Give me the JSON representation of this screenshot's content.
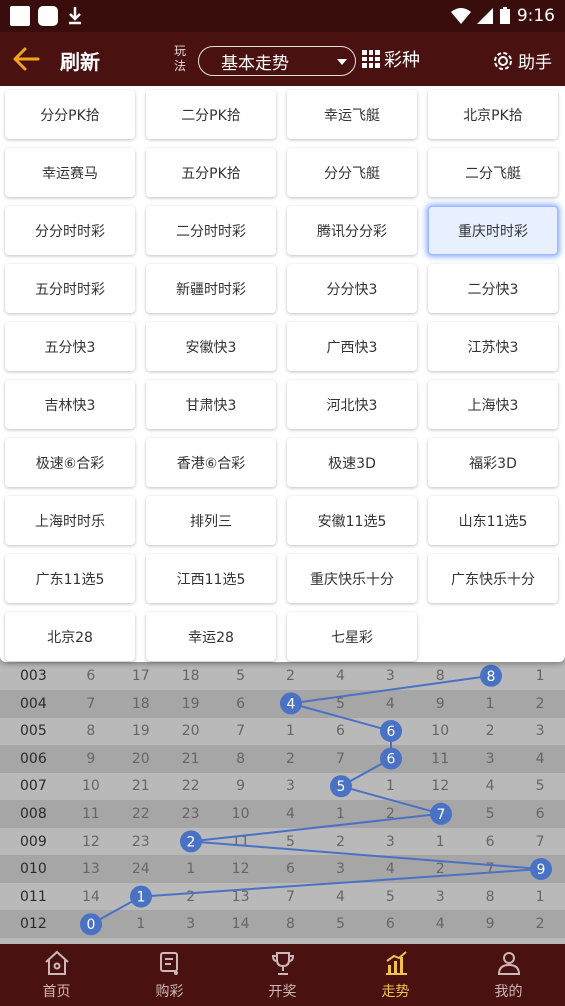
{
  "status_bar": {
    "time": "9:16"
  },
  "topbar": {
    "refresh_label": "刷新",
    "play_mode_label": "玩法",
    "mode_value": "基本走势",
    "lottery_type_label": "彩种",
    "helper_label": "助手"
  },
  "lotteries": [
    "分分PK拾",
    "二分PK拾",
    "幸运飞艇",
    "北京PK拾",
    "幸运赛马",
    "五分PK拾",
    "分分飞艇",
    "二分飞艇",
    "分分时时彩",
    "二分时时彩",
    "腾讯分分彩",
    "重庆时时彩",
    "五分时时彩",
    "新疆时时彩",
    "分分快3",
    "二分快3",
    "五分快3",
    "安徽快3",
    "广西快3",
    "江苏快3",
    "吉林快3",
    "甘肃快3",
    "河北快3",
    "上海快3",
    "极速⑥合彩",
    "香港⑥合彩",
    "极速3D",
    "福彩3D",
    "上海时时乐",
    "排列三",
    "安徽11选5",
    "山东11选5",
    "广东11选5",
    "江西11选5",
    "重庆快乐十分",
    "广东快乐十分",
    "北京28",
    "幸运28",
    "七星彩"
  ],
  "selected_lottery": "重庆时时彩",
  "trend_rows": [
    {
      "issue": "003",
      "cells": [
        "6",
        "17",
        "18",
        "5",
        "2",
        "4",
        "3",
        "8",
        "8",
        "1"
      ]
    },
    {
      "issue": "004",
      "cells": [
        "7",
        "18",
        "19",
        "6",
        "4",
        "5",
        "4",
        "9",
        "1",
        "2"
      ]
    },
    {
      "issue": "005",
      "cells": [
        "8",
        "19",
        "20",
        "7",
        "1",
        "6",
        "6",
        "10",
        "2",
        "3"
      ]
    },
    {
      "issue": "006",
      "cells": [
        "9",
        "20",
        "21",
        "8",
        "2",
        "7",
        "6",
        "11",
        "3",
        "4"
      ]
    },
    {
      "issue": "007",
      "cells": [
        "10",
        "21",
        "22",
        "9",
        "3",
        "5",
        "1",
        "12",
        "4",
        "5"
      ]
    },
    {
      "issue": "008",
      "cells": [
        "11",
        "22",
        "23",
        "10",
        "4",
        "1",
        "2",
        "7",
        "5",
        "6"
      ]
    },
    {
      "issue": "009",
      "cells": [
        "12",
        "23",
        "2",
        "11",
        "5",
        "2",
        "3",
        "1",
        "6",
        "7"
      ]
    },
    {
      "issue": "010",
      "cells": [
        "13",
        "24",
        "1",
        "12",
        "6",
        "3",
        "4",
        "2",
        "7",
        "9"
      ]
    },
    {
      "issue": "011",
      "cells": [
        "14",
        "1",
        "2",
        "13",
        "7",
        "4",
        "5",
        "3",
        "8",
        "1"
      ]
    },
    {
      "issue": "012",
      "cells": [
        "0",
        "1",
        "3",
        "14",
        "8",
        "5",
        "6",
        "4",
        "9",
        "2"
      ]
    }
  ],
  "trend_hits": [
    {
      "row": 0,
      "col": 8,
      "value": "8"
    },
    {
      "row": 1,
      "col": 4,
      "value": "4"
    },
    {
      "row": 2,
      "col": 6,
      "value": "6"
    },
    {
      "row": 3,
      "col": 6,
      "value": "6"
    },
    {
      "row": 4,
      "col": 5,
      "value": "5"
    },
    {
      "row": 5,
      "col": 7,
      "value": "7"
    },
    {
      "row": 6,
      "col": 2,
      "value": "2"
    },
    {
      "row": 7,
      "col": 9,
      "value": "9"
    },
    {
      "row": 8,
      "col": 1,
      "value": "1"
    },
    {
      "row": 9,
      "col": 0,
      "value": "0"
    }
  ],
  "colors": {
    "accent": "#f2c24b",
    "header": "#4a1111",
    "hit": "#4a72c4"
  },
  "bottom_nav": [
    {
      "label": "首页",
      "icon": "home-icon",
      "active": false
    },
    {
      "label": "购彩",
      "icon": "cart-icon",
      "active": false
    },
    {
      "label": "开奖",
      "icon": "trophy-icon",
      "active": false
    },
    {
      "label": "走势",
      "icon": "chart-icon",
      "active": true
    },
    {
      "label": "我的",
      "icon": "user-icon",
      "active": false
    }
  ]
}
